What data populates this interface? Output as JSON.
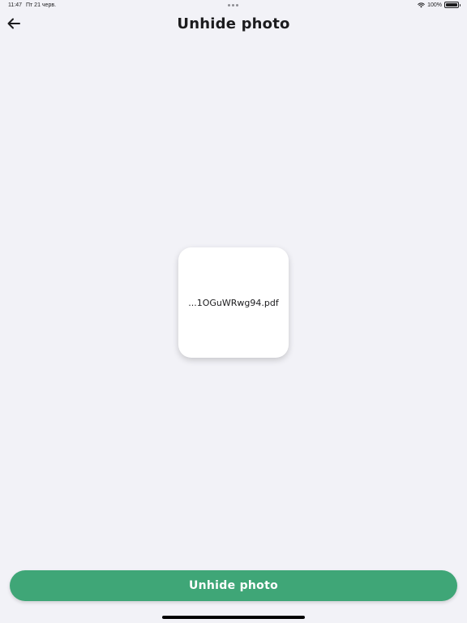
{
  "status_bar": {
    "time": "11:47",
    "date": "Пт 21 черв.",
    "battery_percent": "100%",
    "wifi_icon": "wifi-icon",
    "battery_icon": "battery-icon",
    "multitasking_icon": "multitasking-dots-icon"
  },
  "nav": {
    "back_icon": "arrow-left-icon",
    "title": "Unhide photo"
  },
  "file": {
    "name": "...1OGuWRwg94.pdf"
  },
  "actions": {
    "unhide_label": "Unhide photo"
  },
  "colors": {
    "background": "#f2f2f7",
    "accent": "#3fa677",
    "card": "#ffffff"
  }
}
